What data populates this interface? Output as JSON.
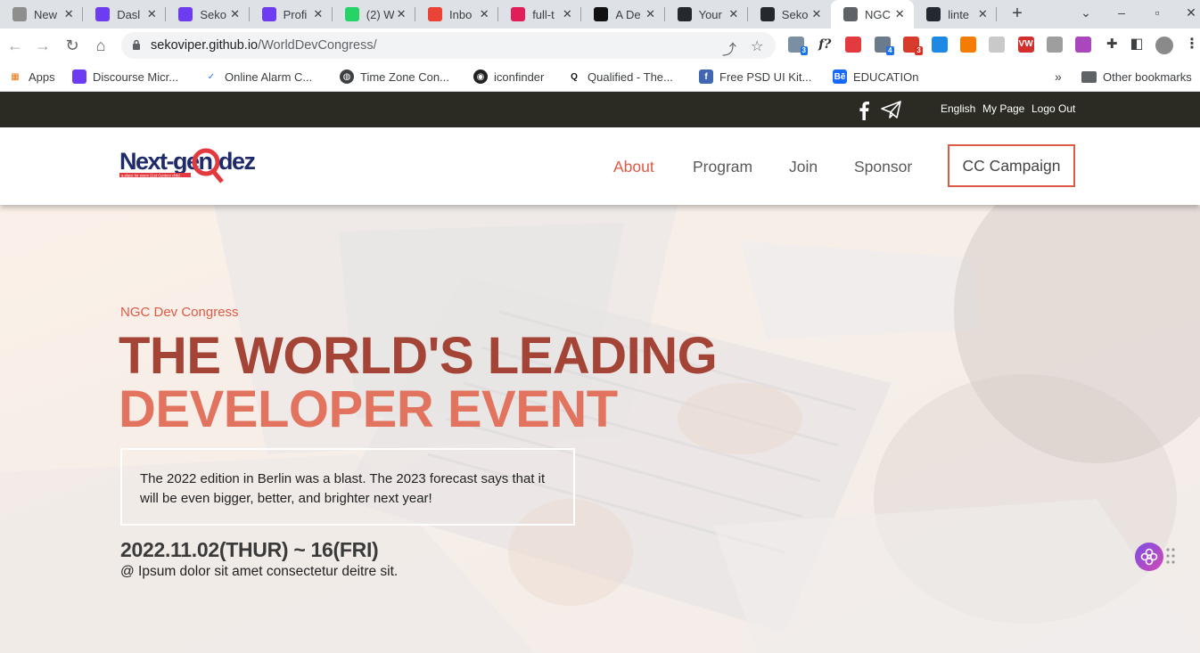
{
  "browser": {
    "tabs": [
      {
        "label": "New",
        "fav": "chatgpt-icon",
        "color": "#8e8e8e"
      },
      {
        "label": "Dasl",
        "fav": "hashnode-icon",
        "color": "#6e3cf0"
      },
      {
        "label": "Seko",
        "fav": "hashnode-icon",
        "color": "#6e3cf0"
      },
      {
        "label": "Profi",
        "fav": "hashnode-icon",
        "color": "#6e3cf0"
      },
      {
        "label": "(2) W",
        "fav": "whatsapp-icon",
        "color": "#25d366"
      },
      {
        "label": "Inbo",
        "fav": "gmail-icon",
        "color": "#ea4335"
      },
      {
        "label": "full-t",
        "fav": "slack-icon",
        "color": "#e01e5a"
      },
      {
        "label": "A De",
        "fav": "medium-icon",
        "color": "#111111"
      },
      {
        "label": "Your",
        "fav": "github-icon",
        "color": "#24292f"
      },
      {
        "label": "Seko",
        "fav": "github-icon",
        "color": "#24292f"
      },
      {
        "label": "NGC",
        "fav": "globe-icon",
        "color": "#5f6368",
        "active": true
      },
      {
        "label": "linte",
        "fav": "github-icon",
        "color": "#24292f"
      }
    ],
    "url_host": "sekoviper.github.io",
    "url_path": "/WorldDevCongress/",
    "extensions": [
      {
        "name": "mail-extension-icon",
        "badge": "3"
      },
      {
        "name": "font-ninja-icon",
        "text": "f?"
      },
      {
        "name": "lips-extension-icon"
      },
      {
        "name": "flag-extension-icon",
        "badge": "4"
      },
      {
        "name": "grid-extension-icon",
        "badge": "3"
      },
      {
        "name": "paper-plane-extension-icon"
      },
      {
        "name": "ya-extension-icon"
      },
      {
        "name": "page-extension-icon"
      },
      {
        "name": "vw-extension-icon",
        "text": "VW"
      },
      {
        "name": "c-bracket-extension-icon"
      },
      {
        "name": "color-wheel-extension-icon"
      },
      {
        "name": "puzzle-extensions-icon"
      }
    ],
    "bookmarks": [
      {
        "label": "Apps",
        "icon": "apps-grid-icon"
      },
      {
        "label": "Discourse Micr...",
        "icon": "discourse-icon"
      },
      {
        "label": "Online Alarm C...",
        "icon": "alarm-check-icon"
      },
      {
        "label": "Time Zone Con...",
        "icon": "globe-icon"
      },
      {
        "label": "iconfinder",
        "icon": "iconfinder-icon"
      },
      {
        "label": "Qualified - The...",
        "icon": "qualified-icon"
      },
      {
        "label": "Free PSD UI Kit...",
        "icon": "facebook-icon"
      },
      {
        "label": "EDUCATIOn",
        "icon": "behance-icon"
      }
    ],
    "bookmarks_overflow": "»",
    "other_bookmarks": "Other bookmarks"
  },
  "site": {
    "topbar": {
      "links": [
        "English",
        "My Page",
        "Logo Out"
      ]
    },
    "logo_text": "Next-gen Codez",
    "logo_tagline": "a place for every 21st Century child",
    "nav": [
      {
        "label": "About",
        "active": true
      },
      {
        "label": "Program"
      },
      {
        "label": "Join"
      },
      {
        "label": "Sponsor"
      }
    ],
    "cta": "CC Campaign",
    "hero": {
      "eyebrow": "NGC Dev Congress",
      "headline_line1": "THE WORLD'S LEADING",
      "headline_line2": "DEVELOPER EVENT",
      "description": "The 2022 edition in Berlin was a blast. The 2023 forecast says that it will be even bigger, better, and brighter next year!",
      "date": "2022.11.02(THUR) ~ 16(FRI)",
      "venue": "@ Ipsum dolor sit amet consectetur deitre sit."
    }
  },
  "colors": {
    "accent": "#dd5a45",
    "headline_dark": "#a44436",
    "headline_light": "#e2735e",
    "topbar_bg": "#2b2b24"
  }
}
